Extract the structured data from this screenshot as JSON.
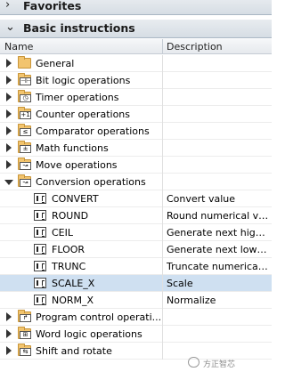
{
  "panels": {
    "favorites_title": "Favorites",
    "basic_title": "Basic instructions"
  },
  "columns": {
    "name": "Name",
    "description": "Description"
  },
  "tree": [
    {
      "label": "General",
      "badge": "",
      "expanded": false
    },
    {
      "label": "Bit logic operations",
      "badge": "⊣⊢",
      "expanded": false
    },
    {
      "label": "Timer operations",
      "badge": "◷",
      "expanded": false
    },
    {
      "label": "Counter operations",
      "badge": "+1",
      "expanded": false
    },
    {
      "label": "Comparator operations",
      "badge": "≤",
      "expanded": false
    },
    {
      "label": "Math functions",
      "badge": "±",
      "expanded": false
    },
    {
      "label": "Move operations",
      "badge": "↝",
      "expanded": false
    },
    {
      "label": "Conversion operations",
      "badge": "↝",
      "expanded": true
    },
    {
      "label": "CONVERT",
      "desc": "Convert value",
      "child": true
    },
    {
      "label": "ROUND",
      "desc": "Round numerical val...",
      "child": true
    },
    {
      "label": "CEIL",
      "desc": "Generate next highe...",
      "child": true
    },
    {
      "label": "FLOOR",
      "desc": "Generate next lower ...",
      "child": true
    },
    {
      "label": "TRUNC",
      "desc": "Truncate numerical ...",
      "child": true
    },
    {
      "label": "SCALE_X",
      "desc": "Scale",
      "child": true,
      "selected": true
    },
    {
      "label": "NORM_X",
      "desc": "Normalize",
      "child": true
    },
    {
      "label": "Program control operati...",
      "badge": "↱",
      "expanded": false
    },
    {
      "label": "Word logic operations",
      "badge": "⊞",
      "expanded": false
    },
    {
      "label": "Shift and rotate",
      "badge": "⇆",
      "expanded": false
    }
  ],
  "watermark": "方正智芯"
}
